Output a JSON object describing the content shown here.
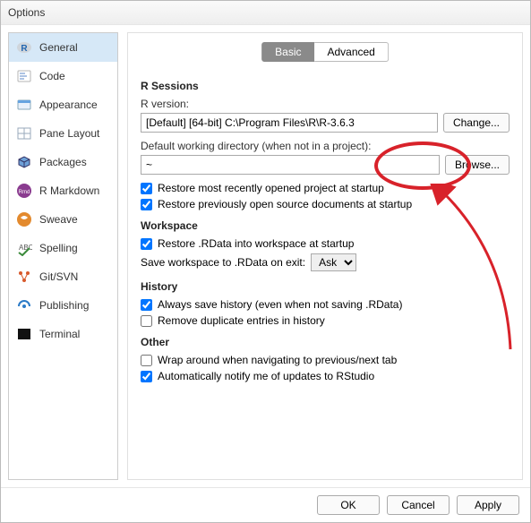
{
  "dialog": {
    "title": "Options"
  },
  "sidebar": {
    "items": [
      {
        "id": "general",
        "label": "General"
      },
      {
        "id": "code",
        "label": "Code"
      },
      {
        "id": "appearance",
        "label": "Appearance"
      },
      {
        "id": "panelayout",
        "label": "Pane Layout"
      },
      {
        "id": "packages",
        "label": "Packages"
      },
      {
        "id": "rmarkdown",
        "label": "R Markdown"
      },
      {
        "id": "sweave",
        "label": "Sweave"
      },
      {
        "id": "spelling",
        "label": "Spelling"
      },
      {
        "id": "gitsvn",
        "label": "Git/SVN"
      },
      {
        "id": "publishing",
        "label": "Publishing"
      },
      {
        "id": "terminal",
        "label": "Terminal"
      }
    ],
    "active": "general"
  },
  "tabs": {
    "basic": "Basic",
    "advanced": "Advanced",
    "active": "basic"
  },
  "sections": {
    "rsessions": {
      "title": "R Sessions",
      "rversion_label": "R version:",
      "rversion_value": "[Default] [64-bit] C:\\Program Files\\R\\R-3.6.3",
      "change_btn": "Change...",
      "workdir_label": "Default working directory (when not in a project):",
      "workdir_value": "~",
      "browse_btn": "Browse...",
      "restore_project": "Restore most recently opened project at startup",
      "restore_project_checked": true,
      "restore_docs": "Restore previously open source documents at startup",
      "restore_docs_checked": true
    },
    "workspace": {
      "title": "Workspace",
      "restore_rdata": "Restore .RData into workspace at startup",
      "restore_rdata_checked": true,
      "save_label": "Save workspace to .RData on exit:",
      "save_value": "Ask"
    },
    "history": {
      "title": "History",
      "always_save": "Always save history (even when not saving .RData)",
      "always_save_checked": true,
      "remove_dupes": "Remove duplicate entries in history",
      "remove_dupes_checked": false
    },
    "other": {
      "title": "Other",
      "wrap_tab": "Wrap around when navigating to previous/next tab",
      "wrap_tab_checked": false,
      "auto_update": "Automatically notify me of updates to RStudio",
      "auto_update_checked": true
    }
  },
  "footer": {
    "ok": "OK",
    "cancel": "Cancel",
    "apply": "Apply"
  }
}
